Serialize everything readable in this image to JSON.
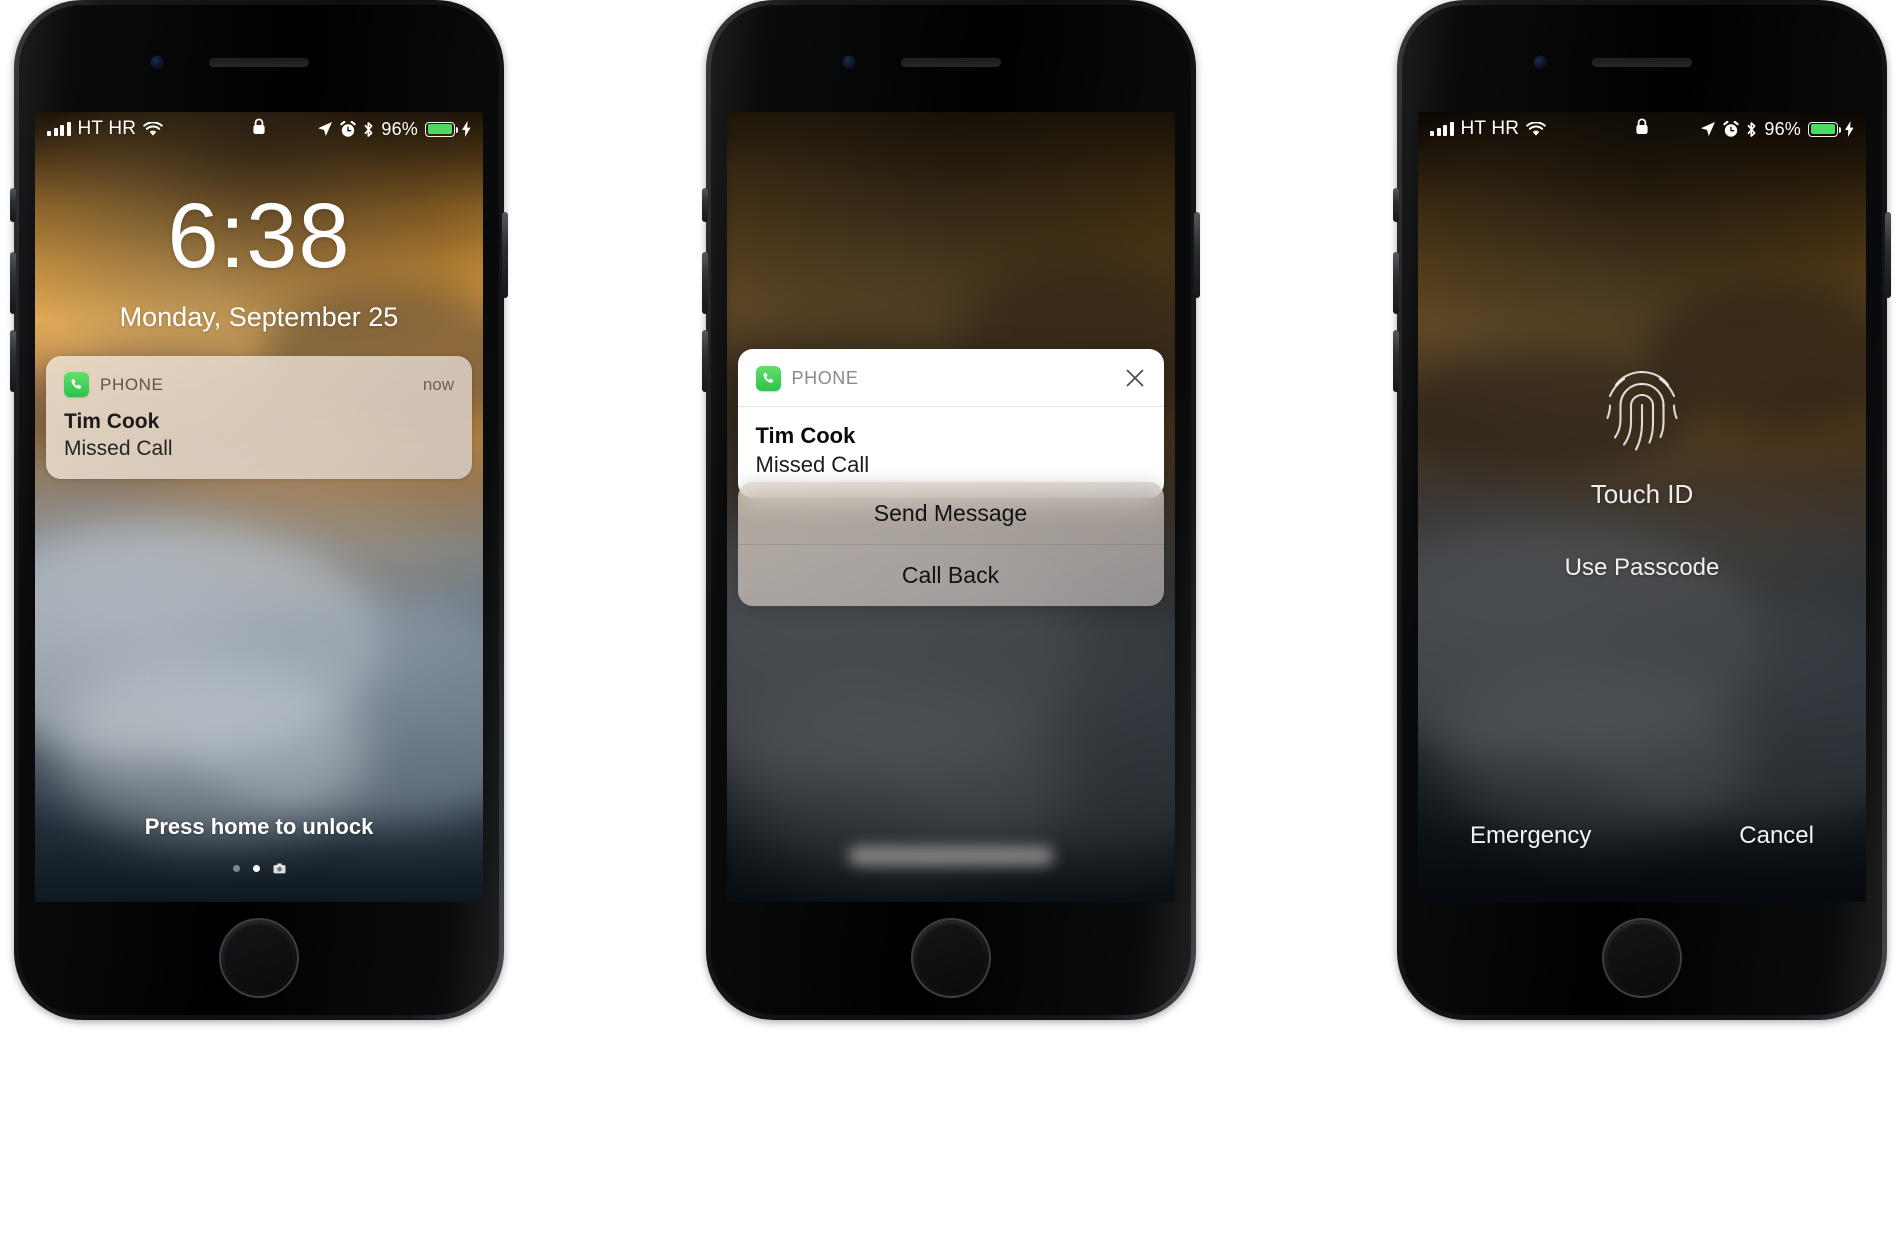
{
  "status_bar": {
    "signal_icon": "cellular-signal-icon",
    "carrier": "HT HR",
    "wifi_icon": "wifi-icon",
    "lock_icon": "lock-icon",
    "location_icon": "location-arrow-icon",
    "alarm_icon": "alarm-clock-icon",
    "bluetooth_icon": "bluetooth-icon",
    "battery_percent": "96%",
    "battery_icon": "battery-icon",
    "charging_icon": "charging-bolt-icon"
  },
  "phone1": {
    "name": "lock-screen-with-notification",
    "clock": "6:38",
    "date": "Monday, September 25",
    "notification": {
      "app_icon": "phone-app-icon",
      "app_name": "PHONE",
      "time": "now",
      "title": "Tim Cook",
      "subtitle": "Missed Call"
    },
    "unlock_hint": "Press home to unlock",
    "page_dots": [
      "widgets",
      "lockscreen",
      "camera"
    ]
  },
  "phone2": {
    "name": "notification-3d-touch-actions",
    "card": {
      "app_icon": "phone-app-icon",
      "app_name": "PHONE",
      "close_icon": "close-x-icon",
      "title": "Tim Cook",
      "subtitle": "Missed Call"
    },
    "actions": [
      {
        "label": "Send Message",
        "icon": "send-message-action"
      },
      {
        "label": "Call Back",
        "icon": "call-back-action"
      }
    ]
  },
  "phone3": {
    "name": "touch-id-unlock-screen",
    "fingerprint_icon": "fingerprint-icon",
    "touch_id_label": "Touch ID",
    "use_passcode": "Use Passcode",
    "emergency": "Emergency",
    "cancel": "Cancel"
  },
  "colors": {
    "accent_green": "#4cd964",
    "phone_app_green": "#3ac84a",
    "card_white": "#ffffff",
    "device_black": "#0e0f10"
  }
}
